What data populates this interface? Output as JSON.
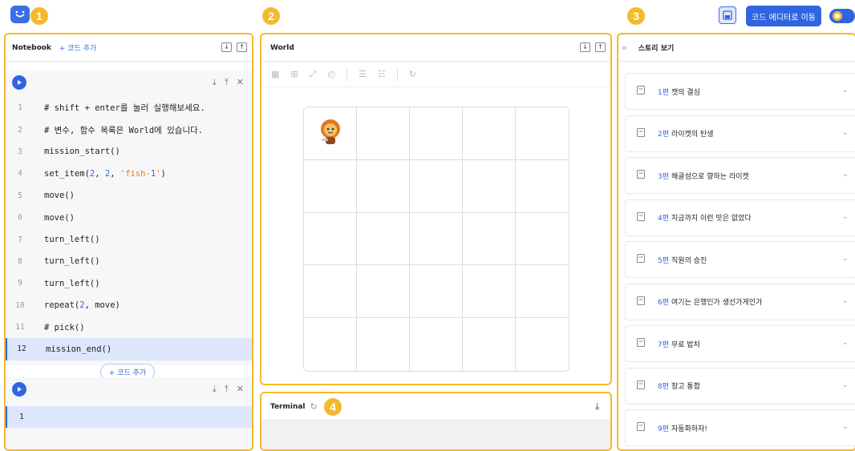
{
  "app": {
    "logo_icon": "smile-icon",
    "badges": [
      "1",
      "2",
      "3",
      "4"
    ],
    "save_icon": "save-icon",
    "move_button": "코드 에디터로 이동",
    "accent": "#2f66e0",
    "highlight": "#f5b92e"
  },
  "notebook": {
    "title": "Notebook",
    "add_code": "+ 코드 추가",
    "float_add": "+ 코드 추가",
    "cell1": {
      "lines": [
        {
          "no": "1",
          "text": "# shift + enter를 눌러 실행해보세요."
        },
        {
          "no": "2",
          "text": "# 변수, 함수 목록은 World에 있습니다."
        },
        {
          "no": "3",
          "text": "mission_start()"
        },
        {
          "no": "4",
          "text": "set_item(2, 2, 'fish-1')"
        },
        {
          "no": "5",
          "text": "move()"
        },
        {
          "no": "6",
          "text": "move()"
        },
        {
          "no": "7",
          "text": "turn_left()"
        },
        {
          "no": "8",
          "text": "turn_left()"
        },
        {
          "no": "9",
          "text": "turn_left()"
        },
        {
          "no": "10",
          "text": "repeat(2, move)"
        },
        {
          "no": "11",
          "text": "# pick()"
        },
        {
          "no": "12",
          "text": "mission_end()"
        }
      ]
    },
    "cell2": {
      "lines": [
        {
          "no": "1",
          "text": ""
        }
      ]
    }
  },
  "world": {
    "title": "World",
    "grid_size": 5,
    "character": "lion-character-icon"
  },
  "terminal": {
    "title": "Terminal"
  },
  "story": {
    "title": "스토리 보기",
    "items": [
      {
        "num": "1편",
        "title": "캣의 결심"
      },
      {
        "num": "2편",
        "title": "라이캣의 탄생"
      },
      {
        "num": "3편",
        "title": "해골섬으로 향하는 라이캣"
      },
      {
        "num": "4편",
        "title": "지금까지 이런 맛은 없었다"
      },
      {
        "num": "5편",
        "title": "직원의 승진"
      },
      {
        "num": "6편",
        "title": "여기는 은행인가 생선가게인가"
      },
      {
        "num": "7편",
        "title": "무료 밥차"
      },
      {
        "num": "8편",
        "title": "창고 통합"
      },
      {
        "num": "9편",
        "title": "자동화하자!"
      }
    ]
  }
}
